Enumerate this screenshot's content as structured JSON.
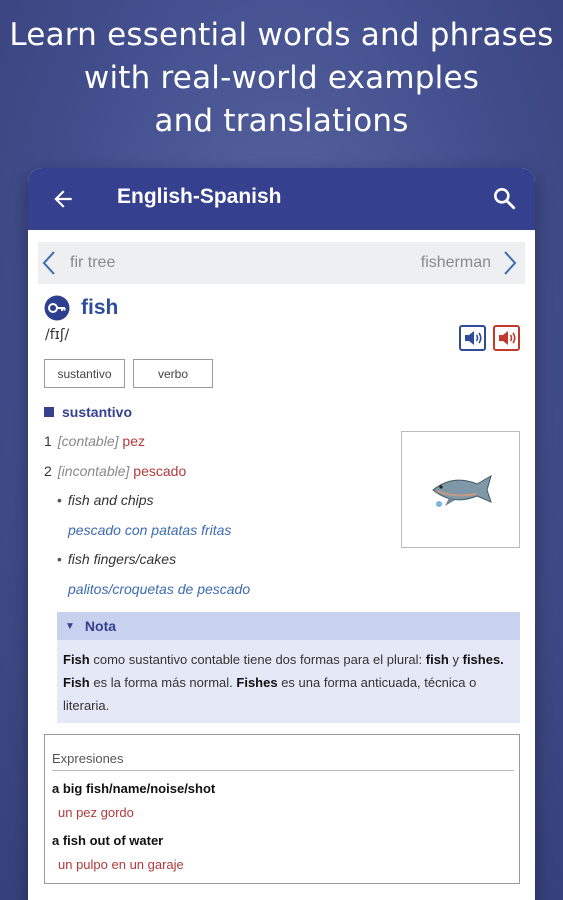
{
  "promo": {
    "line1": "Learn essential words and phrases",
    "line2": "with real-world examples",
    "line3": "and translations"
  },
  "appbar": {
    "title": "English-Spanish",
    "back_icon": "arrow-left-icon",
    "search_icon": "search-icon",
    "color": "#35408f"
  },
  "nav": {
    "prev": "fir tree",
    "next": "fisherman"
  },
  "entry": {
    "headword": "fish",
    "pronunciation": "/fɪʃ/",
    "pos_chips": [
      "sustantivo",
      "verbo"
    ],
    "pos_heading": "sustantivo",
    "senses": [
      {
        "num": "1",
        "grammar": "[contable]",
        "translation": "pez"
      },
      {
        "num": "2",
        "grammar": "[incontable]",
        "translation": "pescado"
      }
    ],
    "examples": [
      {
        "source": "fish and chips",
        "translation": "pescado con patatas fritas"
      },
      {
        "source": "fish fingers/cakes",
        "translation": "palitos/croquetas de pescado"
      }
    ]
  },
  "note": {
    "title": "Nota",
    "parts": {
      "p1": "Fish",
      "p2": " como sustantivo contable tiene dos formas para el plural: ",
      "p3": "fish",
      "p4": " y ",
      "p5": "fishes.",
      "p6": " ",
      "p7": "Fish",
      "p8": " es la forma más normal. ",
      "p9": "Fishes",
      "p10": " es una forma anticuada, técnica o literaria."
    }
  },
  "phrases": {
    "title": "Expresiones",
    "items": [
      {
        "phrase": "a big fish/name/noise/shot",
        "translation": "un pez gordo"
      },
      {
        "phrase": "a fish out of water",
        "translation": "un pulpo en un garaje"
      }
    ]
  }
}
